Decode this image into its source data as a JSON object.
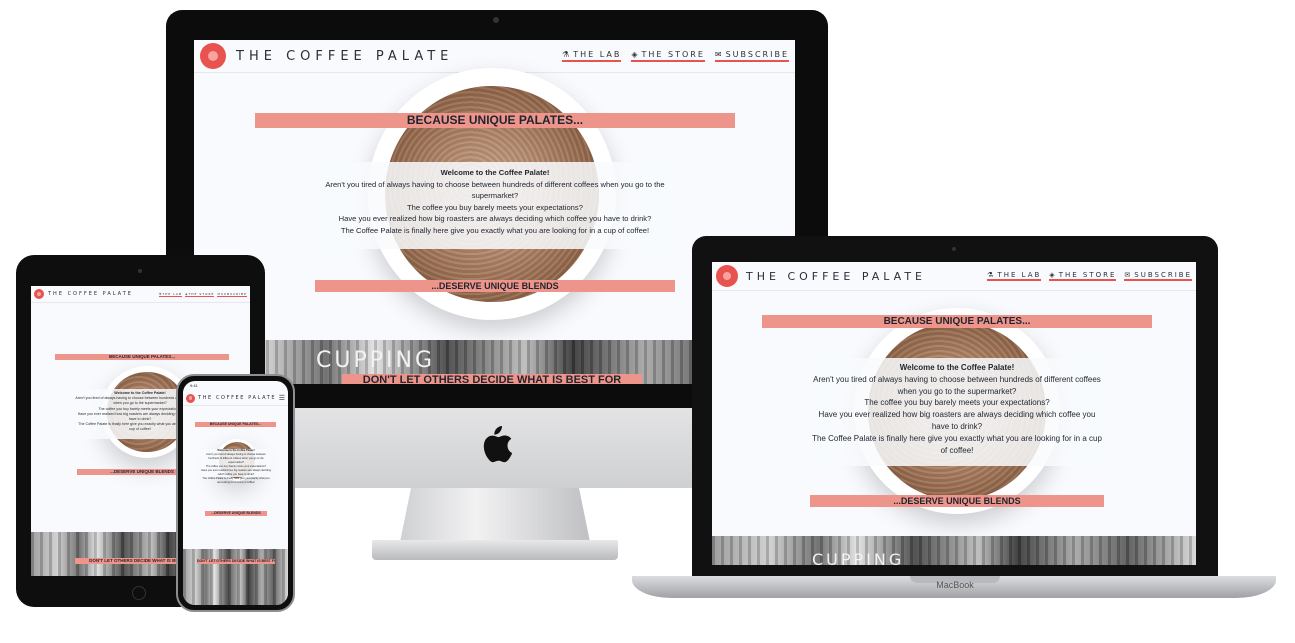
{
  "site": {
    "brand": "THE COFFEE PALATE",
    "nav": [
      {
        "icon": "flask-icon",
        "glyph": "⚗",
        "label": "THE LAB"
      },
      {
        "icon": "gem-icon",
        "glyph": "◈",
        "label": "THE STORE"
      },
      {
        "icon": "envelope-icon",
        "glyph": "✉",
        "label": "SUBSCRIBE"
      }
    ],
    "hero_top": "BECAUSE UNIQUE PALATES...",
    "hero_bottom": "...DESERVE UNIQUE BLENDS",
    "welcome_title": "Welcome to the Coffee Palate!",
    "welcome_line1": "Aren't you tired of always having to choose between hundreds of different coffees when you go to the supermarket?",
    "welcome_line2": "The coffee you buy barely meets your expectations?",
    "welcome_line3": "Have you ever realized how big roasters are always deciding which coffee you have to drink?",
    "welcome_line4": "The Coffee Palate is finally here give you exactly what you are looking for in a cup of coffee!",
    "second_banner": "DON'T LET OTHERS DECIDE WHAT IS BEST FOR",
    "photo_sign": "CUPPING"
  },
  "device": {
    "macbook_label": "MacBook",
    "apple_logo": "",
    "iphone_time": "9:41"
  },
  "colors": {
    "accent": "#ee958b",
    "logo": "#e8524f",
    "text": "#1f2530",
    "background": "#f8fafd"
  }
}
